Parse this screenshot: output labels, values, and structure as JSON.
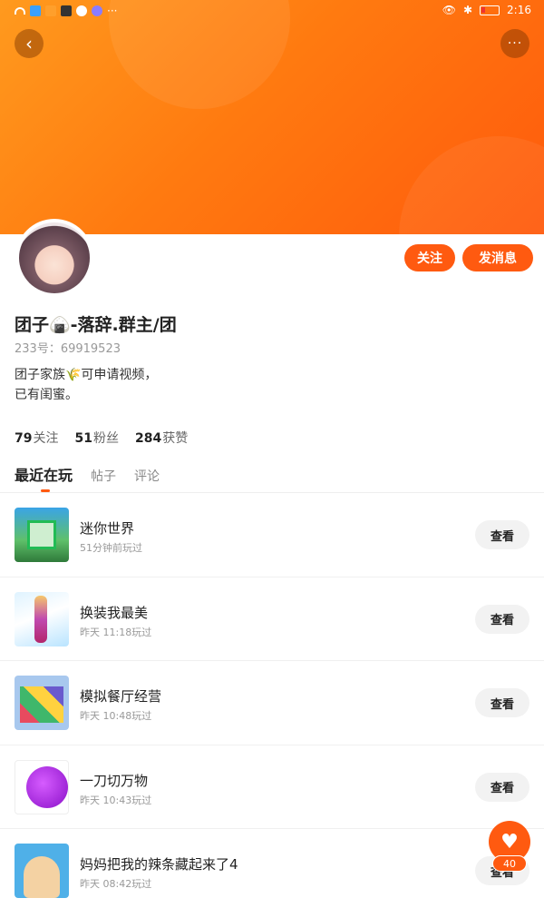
{
  "status_bar": {
    "time": "2:16"
  },
  "header": {
    "more_icon": "···"
  },
  "profile": {
    "username": "团子🍙-落辞.群主/团",
    "uid_label": "233号：69919523",
    "bio_line1": "团子家族🌾可申请视频，",
    "bio_line2": "已有闺蜜。",
    "follow_label": "关注",
    "message_label": "发消息"
  },
  "stats": {
    "following_count": "79",
    "following_label": "关注",
    "fans_count": "51",
    "fans_label": "粉丝",
    "likes_count": "284",
    "likes_label": "获赞"
  },
  "tabs": [
    "最近在玩",
    "帖子",
    "评论"
  ],
  "games": [
    {
      "name": "迷你世界",
      "time": "51分钟前玩过",
      "action": "查看"
    },
    {
      "name": "换装我最美",
      "time": "昨天 11:18玩过",
      "action": "查看"
    },
    {
      "name": "模拟餐厅经营",
      "time": "昨天 10:48玩过",
      "action": "查看"
    },
    {
      "name": "一刀切万物",
      "time": "昨天 10:43玩过",
      "action": "查看"
    },
    {
      "name": "妈妈把我的辣条藏起来了4",
      "time": "昨天 08:42玩过",
      "action": "查看"
    }
  ],
  "fab": {
    "count": "40"
  }
}
